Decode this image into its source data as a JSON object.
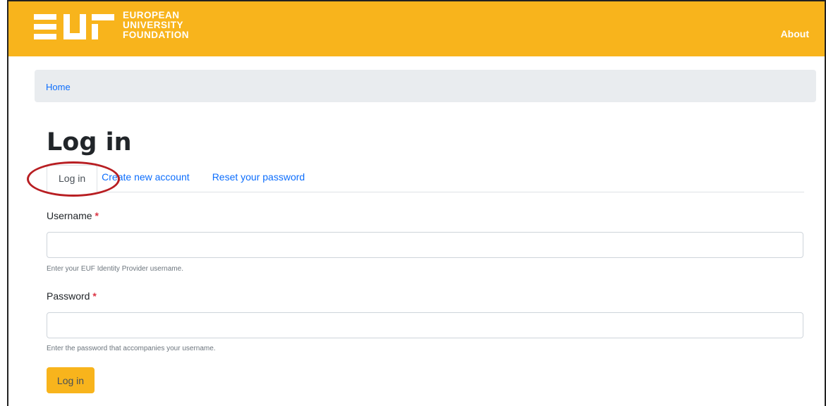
{
  "header": {
    "logo_letters": "EUF",
    "logo_lines": [
      "EUROPEAN",
      "UNIVERSITY",
      "FOUNDATION"
    ],
    "about_label": "About",
    "bg_color": "#f8b41c"
  },
  "breadcrumb": {
    "home_label": "Home"
  },
  "page": {
    "title": "Log in"
  },
  "tabs": [
    {
      "label": "Log in",
      "active": true
    },
    {
      "label": "Create new account",
      "active": false
    },
    {
      "label": "Reset your password",
      "active": false
    }
  ],
  "form": {
    "username": {
      "label": "Username",
      "required_mark": "*",
      "value": "",
      "help": "Enter your EUF Identity Provider username."
    },
    "password": {
      "label": "Password",
      "required_mark": "*",
      "value": "",
      "help": "Enter the password that accompanies your username."
    },
    "submit_label": "Log in"
  },
  "annotation": {
    "color": "#b81e22",
    "target": "Log in tab"
  }
}
